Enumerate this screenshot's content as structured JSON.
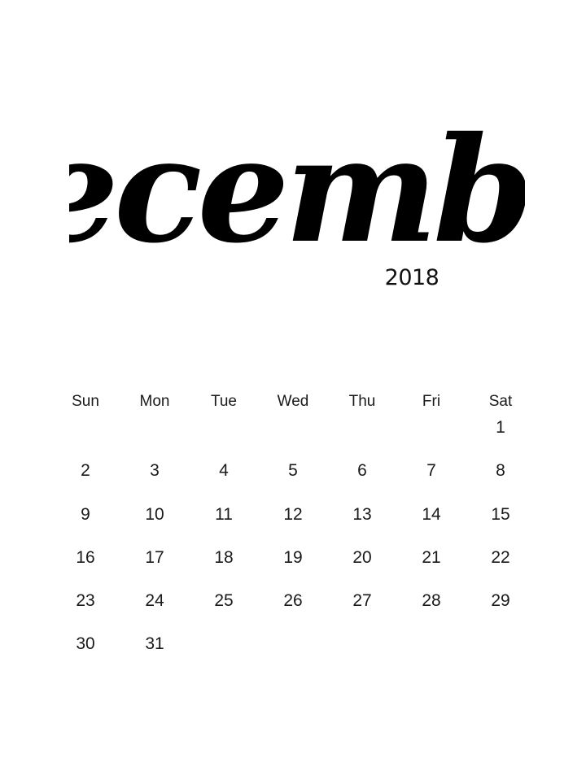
{
  "calendar": {
    "month": "December",
    "year": "2018",
    "weekday_headers": [
      "Sun",
      "Mon",
      "Tue",
      "Wed",
      "Thu",
      "Fri",
      "Sat"
    ],
    "weeks": [
      [
        "",
        "",
        "",
        "",
        "",
        "",
        "1"
      ],
      [
        "2",
        "3",
        "4",
        "5",
        "6",
        "7",
        "8"
      ],
      [
        "9",
        "10",
        "11",
        "12",
        "13",
        "14",
        "15"
      ],
      [
        "16",
        "17",
        "18",
        "19",
        "20",
        "21",
        "22"
      ],
      [
        "23",
        "24",
        "25",
        "26",
        "27",
        "28",
        "29"
      ],
      [
        "30",
        "31",
        "",
        "",
        "",
        "",
        ""
      ]
    ],
    "colors": {
      "background": "#ffffff",
      "text": "#000000"
    }
  }
}
